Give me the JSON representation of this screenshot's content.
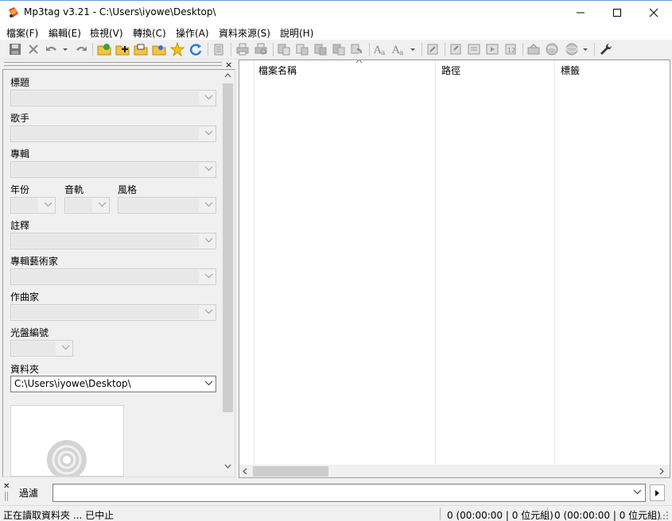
{
  "window": {
    "title": "Mp3tag v3.21  -  C:\\Users\\iyowe\\Desktop\\",
    "controls": {
      "minimize": "minimize-icon",
      "maximize": "maximize-icon",
      "close": "close-icon"
    }
  },
  "menu": {
    "file": "檔案(F)",
    "edit": "編輯(E)",
    "view": "檢視(V)",
    "convert": "轉換(C)",
    "actions": "操作(A)",
    "sources": "資料來源(S)",
    "help": "說明(H)"
  },
  "toolbar": {
    "icons": [
      "save-icon",
      "remove-tag-icon",
      "undo-icon",
      "undo-dropdown-icon",
      "redo-icon",
      "change-directory-icon",
      "add-directory-icon",
      "favorite-directory-icon",
      "open-playlist-icon",
      "favorites-icon",
      "refresh-icon",
      "extended-tags-icon",
      "print-icon",
      "print-preview-icon",
      "tag-filename-icon",
      "filename-tag-icon",
      "text-file-tag-icon",
      "tag-tag-icon",
      "filename-filename-icon",
      "case-conversion-icon",
      "case-conversion-words-icon",
      "text-dropdown-icon",
      "cut-icon",
      "export-icon",
      "playlist-icon",
      "numbering-wizard-icon",
      "autonumber-icon",
      "tag-sources-icon",
      "web-source-icon",
      "web-source-dropdown-icon",
      "options-icon"
    ]
  },
  "tag_panel": {
    "close": "×",
    "title_label": "標題",
    "artist_label": "歌手",
    "album_label": "專輯",
    "year_label": "年份",
    "track_label": "音軌",
    "genre_label": "風格",
    "comment_label": "註釋",
    "albumartist_label": "專輯藝術家",
    "composer_label": "作曲家",
    "discnumber_label": "光盤編號",
    "directory_label": "資料夾",
    "directory_value": "C:\\Users\\iyowe\\Desktop\\"
  },
  "file_list": {
    "columns": [
      "檔案名稱",
      "路徑",
      "標籤"
    ],
    "sorted_column": "檔案名稱",
    "rows": []
  },
  "filter": {
    "label": "過濾",
    "value": ""
  },
  "status": {
    "message": "正在讀取資料夾 ... 已中止",
    "selected": "0 (00:00:00 | 0 位元組)",
    "total": "0 (00:00:00 | 0 位元組)"
  }
}
